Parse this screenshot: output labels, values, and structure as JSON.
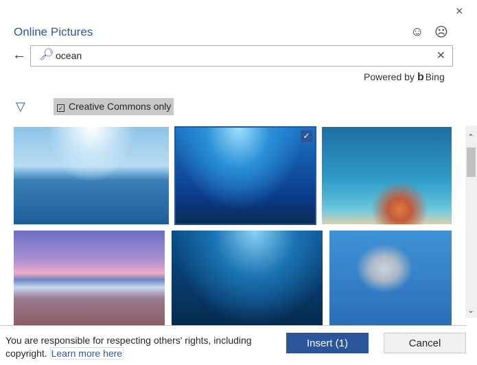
{
  "dialog": {
    "title": "Online Pictures",
    "close_icon": "×",
    "smile_icon": "☺",
    "frown_icon": "☹"
  },
  "search": {
    "back_icon": "←",
    "value": "ocean",
    "clear_icon": "✕"
  },
  "powered": {
    "label": "Powered by",
    "brand": "Bing"
  },
  "filter": {
    "icon": "▽",
    "checkbox_label": "Creative Commons only",
    "checked": true,
    "check_mark": "✓"
  },
  "results": {
    "selected_index": 1,
    "images": [
      "ocean horizon with sun rays",
      "underwater sunbeams",
      "coral reef with fish",
      "beach at sunset",
      "underwater fish in light",
      "dolphins underwater"
    ]
  },
  "scrollbar": {
    "up": "⌃",
    "down": "⌄"
  },
  "footer": {
    "note": "You are responsible for respecting others' rights, including copyright.",
    "link": "Learn more here",
    "insert_label": "Insert (1)",
    "cancel_label": "Cancel"
  },
  "colors": {
    "accent": "#2b579a"
  }
}
